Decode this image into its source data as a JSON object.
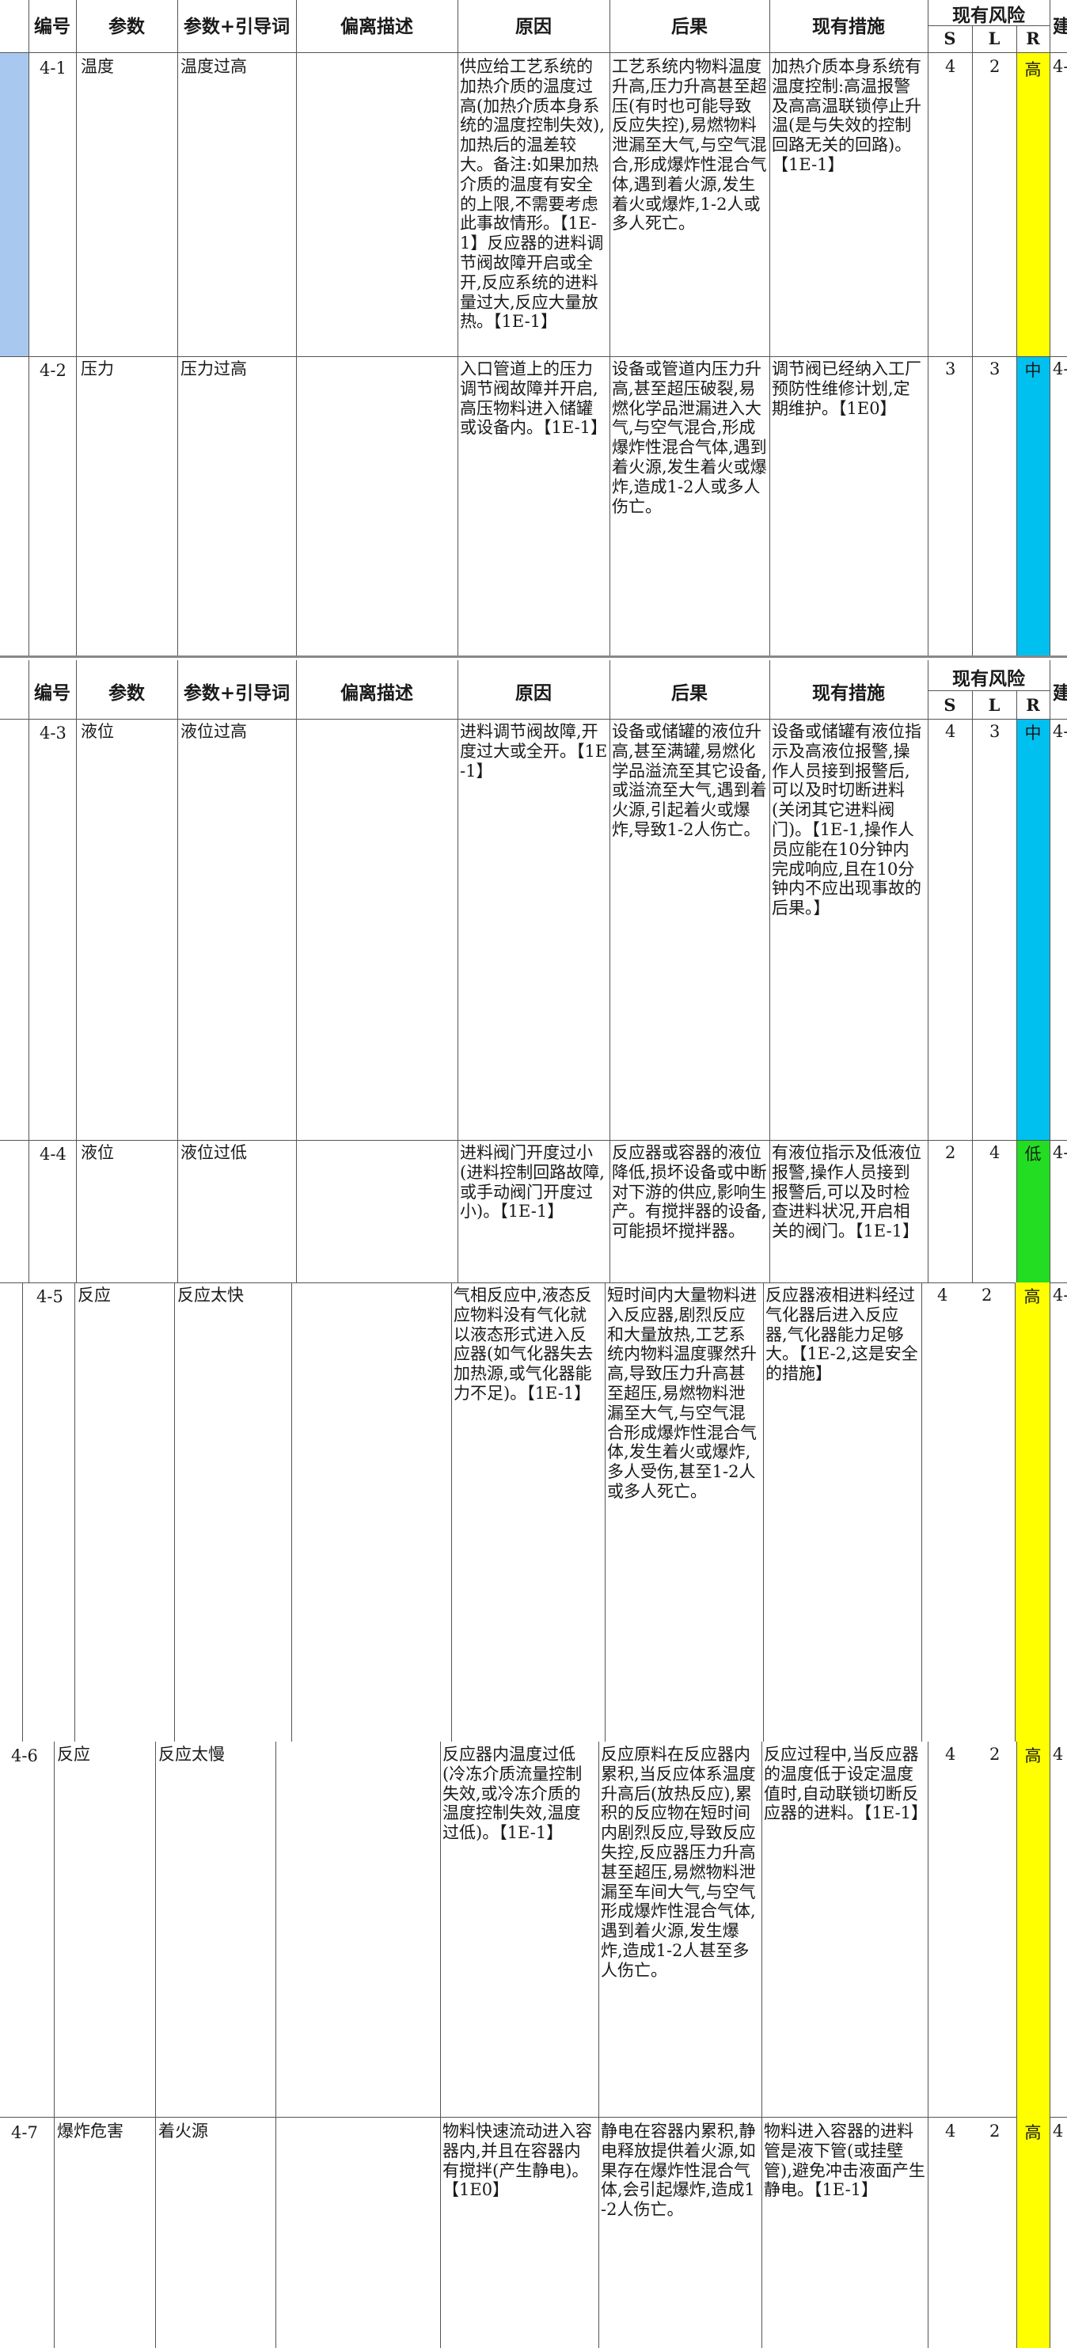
{
  "header": {
    "id": "编号",
    "param": "参数",
    "param_guide": "参数+引导词",
    "deviation": "偏离描述",
    "cause": "原因",
    "consequence": "后果",
    "measures": "现有措施",
    "risk": "现有风险",
    "s": "S",
    "l": "L",
    "r": "R",
    "cut": "建"
  },
  "rows": [
    {
      "id": "4-1",
      "param": "温度",
      "guide": "温度过高",
      "cause": "供应给工艺系统的加热介质的温度过高(加热介质本身系统的温度控制失效),加热后的温差较大。备注:如果加热介质的温度有安全的上限,不需要考虑此事故情形。【1E-1】反应器的进料调节阀故障开启或全开,反应系统的进料量过大,反应大量放热。【1E-1】",
      "consequence": "工艺系统内物料温度升高,压力升高甚至超压(有时也可能导致反应失控),易燃物料泄漏至大气,与空气混合,形成爆炸性混合气体,遇到着火源,发生着火或爆炸,1-2人或多人死亡。",
      "measures": "加热介质本身系统有温度控制:高温报警及高高温联锁停止升温(是与失效的控制回路无关的回路)。【1E-1】",
      "s": "4",
      "l": "2",
      "r": "高",
      "color": "#ffff00",
      "next": "4-"
    },
    {
      "id": "4-2",
      "param": "压力",
      "guide": "压力过高",
      "cause": "入口管道上的压力调节阀故障并开启,高压物料进入储罐或设备内。【1E-1】",
      "consequence": "设备或管道内压力升高,甚至超压破裂,易燃化学品泄漏进入大气,与空气混合,形成爆炸性混合气体,遇到着火源,发生着火或爆炸,造成1-2人或多人伤亡。",
      "measures": "调节阀已经纳入工厂预防性维修计划,定期维护。【1E0】",
      "s": "3",
      "l": "3",
      "r": "中",
      "color": "#00c0f0",
      "next": "4-"
    },
    {
      "id": "4-3",
      "param": "液位",
      "guide": "液位过高",
      "cause": "进料调节阀故障,开度过大或全开。【1E-1】",
      "consequence": "设备或储罐的液位升高,甚至满罐,易燃化学品溢流至其它设备,或溢流至大气,遇到着火源,引起着火或爆炸,导致1-2人伤亡。",
      "measures": "设备或储罐有液位指示及高液位报警,操作人员接到报警后,可以及时切断进料(关闭其它进料阀门)。【1E-1,操作人员应能在10分钟内完成响应,且在10分钟内不应出现事故的后果。】",
      "s": "4",
      "l": "3",
      "r": "中",
      "color": "#00c0f0",
      "next": "4-"
    },
    {
      "id": "4-4",
      "param": "液位",
      "guide": "液位过低",
      "cause": "进料阀门开度过小(进料控制回路故障,或手动阀门开度过小)。【1E-1】",
      "consequence": "反应器或容器的液位降低,损坏设备或中断对下游的供应,影响生产。有搅拌器的设备,可能损坏搅拌器。",
      "measures": "有液位指示及低液位报警,操作人员接到报警后,可以及时检查进料状况,开启相关的阀门。【1E-1】",
      "s": "2",
      "l": "4",
      "r": "低",
      "color": "#22dd22",
      "next": "4-"
    },
    {
      "id": "4-5",
      "param": "反应",
      "guide": "反应太快",
      "cause": "气相反应中,液态反应物料没有气化就以液态形式进入反应器(如气化器失去加热源,或气化器能力不足)。【1E-1】",
      "consequence": "短时间内大量物料进入反应器,剧烈反应和大量放热,工艺系统内物料温度骤然升高,导致压力升高甚至超压,易燃物料泄漏至大气,与空气混合形成爆炸性混合气体,发生着火或爆炸,多人受伤,甚至1-2人或多人死亡。",
      "measures": "反应器液相进料经过气化器后进入反应器,气化器能力足够大。【1E-2,这是安全的措施】",
      "s": "4",
      "l": "2",
      "r": "高",
      "color": "#ffff00",
      "next": "4-"
    },
    {
      "id": "4-6",
      "param": "反应",
      "guide": "反应太慢",
      "cause": "反应器内温度过低(冷冻介质流量控制失效,或冷冻介质的温度控制失效,温度过低)。【1E-1】",
      "consequence": "反应原料在反应器内累积,当反应体系温度升高后(放热反应),累积的反应物在短时间内剧烈反应,导致反应失控,反应器压力升高甚至超压,易燃物料泄漏至车间大气,与空气形成爆炸性混合气体,遇到着火源,发生爆炸,造成1-2人甚至多人伤亡。",
      "measures": "反应过程中,当反应器的温度低于设定温度值时,自动联锁切断反应器的进料。【1E-1】",
      "s": "4",
      "l": "2",
      "r": "高",
      "color": "#ffff00",
      "next": "4"
    },
    {
      "id": "4-7",
      "param": "爆炸危害",
      "guide": "着火源",
      "cause": "物料快速流动进入容器内,并且在容器内有搅拌(产生静电)。【1E0】",
      "consequence": "静电在容器内累积,静电释放提供着火源,如果存在爆炸性混合气体,会引起爆炸,造成1-2人伤亡。",
      "measures": "物料进入容器的进料管是液下管(或挂壁管),避免冲击液面产生静电。【1E-1】",
      "s": "4",
      "l": "2",
      "r": "高",
      "color": "#ffff00",
      "next": "4"
    }
  ]
}
